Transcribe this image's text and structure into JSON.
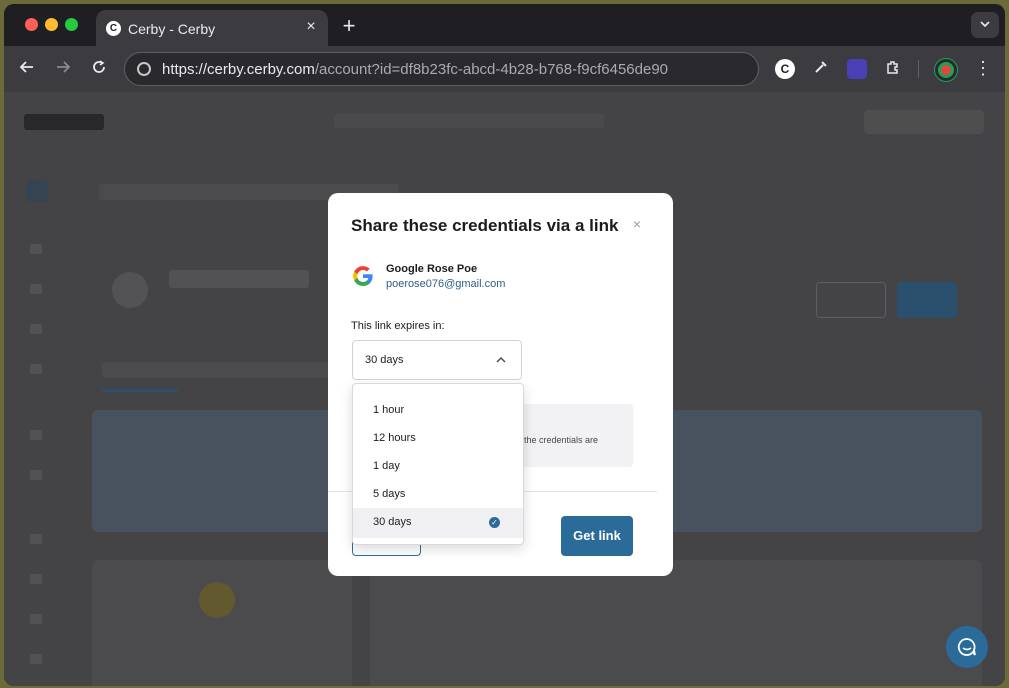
{
  "browser": {
    "tab_title": "Cerby - Cerby",
    "tab_close": "×",
    "new_tab": "+",
    "url_host": "https://cerby.cerby.com",
    "url_path": "/account?id=df8b23fc-abcd-4b28-b768-f9cf6456de90"
  },
  "modal": {
    "title": "Share these credentials via a link",
    "close_glyph": "×",
    "account_name": "Google Rose Poe",
    "account_email": "poerose076@gmail.com",
    "expires_label": "This link expires in:",
    "selected_expiry": "30 days",
    "info_text": "the credentials are",
    "get_link_label": "Get link"
  },
  "dropdown": {
    "options": [
      "1 hour",
      "12 hours",
      "1 day",
      "5 days",
      "30 days"
    ],
    "selected_index": 4
  },
  "colors": {
    "primary": "#2b6b99",
    "link": "#2f5e86"
  }
}
